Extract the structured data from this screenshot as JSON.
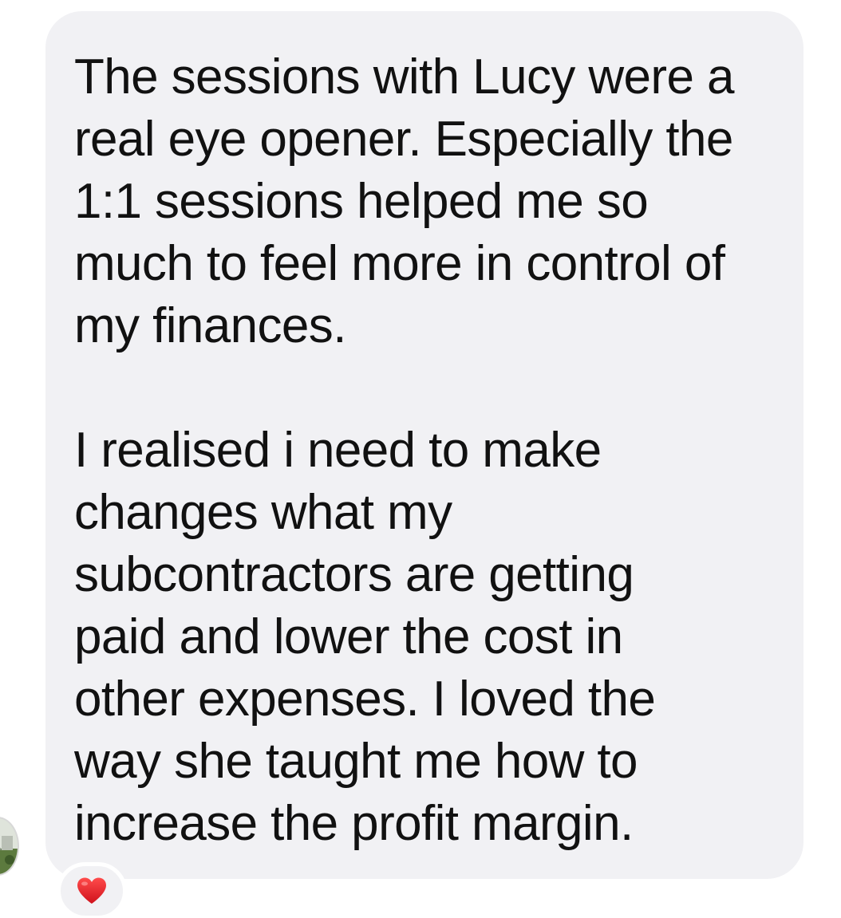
{
  "message": {
    "paragraph_1": "The sessions with Lucy were a\nreal eye opener. Especially the\n1:1 sessions helped me so\nmuch to feel more in control of\nmy finances.",
    "paragraph_2": "I realised i need to make\nchanges what my\nsubcontractors are getting\npaid and lower the cost in\nother expenses. I loved the\nway she taught me how to\nincrease the profit margin."
  },
  "reaction": {
    "icon": "heart-icon",
    "color": "#e0202a"
  },
  "colors": {
    "bubble_background": "#f1f1f4",
    "text": "#111111",
    "page_background": "#ffffff"
  }
}
